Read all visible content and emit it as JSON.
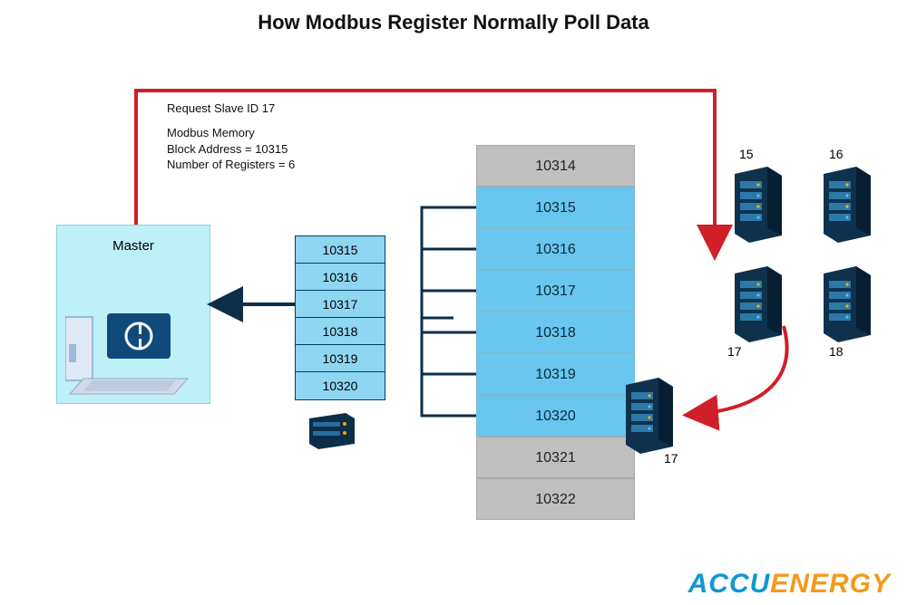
{
  "title": "How Modbus Register Normally Poll Data",
  "request_label": "Request Slave ID 17",
  "memory": {
    "line1": "Modbus Memory",
    "line2": "Block Address = 10315",
    "line3": "Number of Registers = 6"
  },
  "master_label": "Master",
  "registers_returned": [
    "10315",
    "10316",
    "10317",
    "10318",
    "10319",
    "10320"
  ],
  "memory_block": [
    {
      "addr": "10314",
      "hit": false
    },
    {
      "addr": "10315",
      "hit": true
    },
    {
      "addr": "10316",
      "hit": true
    },
    {
      "addr": "10317",
      "hit": true
    },
    {
      "addr": "10318",
      "hit": true
    },
    {
      "addr": "10319",
      "hit": true
    },
    {
      "addr": "10320",
      "hit": true
    },
    {
      "addr": "10321",
      "hit": false
    },
    {
      "addr": "10322",
      "hit": false
    }
  ],
  "slaves": {
    "top_left": "15",
    "top_right": "16",
    "mid_left": "17",
    "mid_right": "18",
    "bottom": "17"
  },
  "logo": {
    "part1": "ACCU",
    "part2": "ENERGY"
  }
}
